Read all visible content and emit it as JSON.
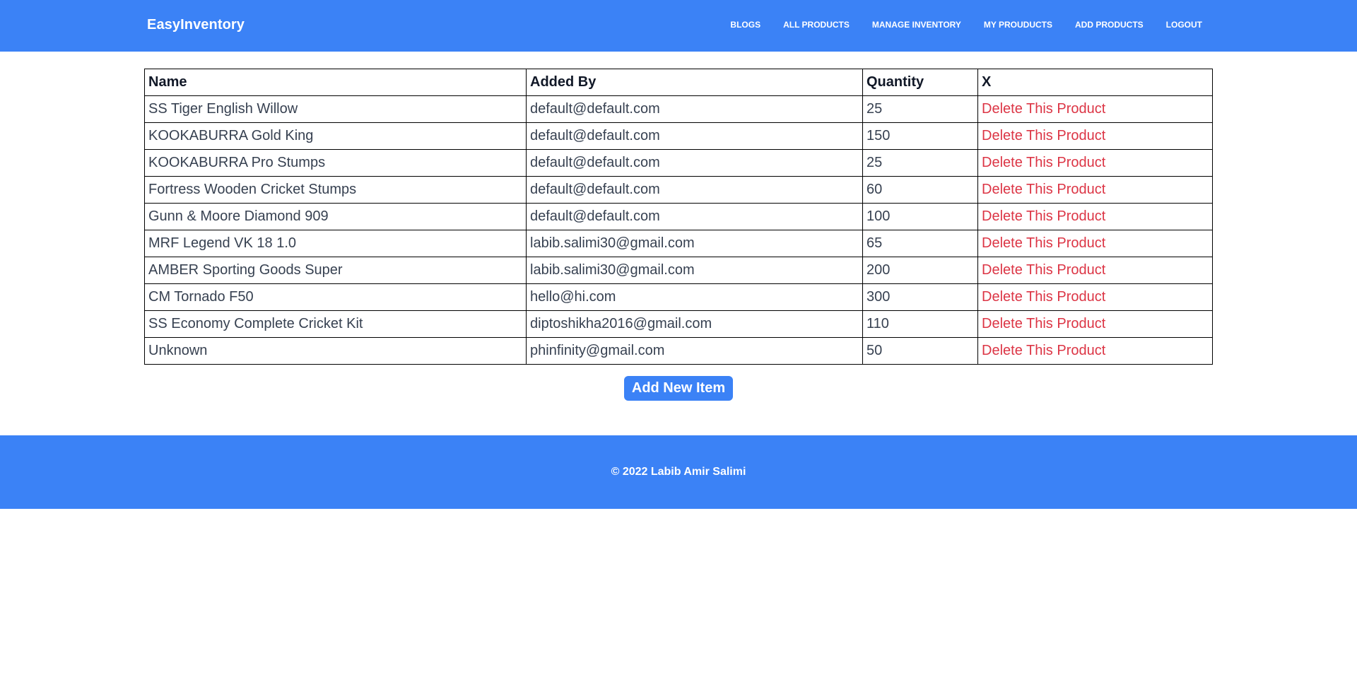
{
  "brand": "EasyInventory",
  "nav": {
    "links": [
      "BLOGS",
      "ALL PRODUCTS",
      "MANAGE INVENTORY",
      "MY PROUDUCTS",
      "ADD PRODUCTS",
      "LOGOUT"
    ]
  },
  "table": {
    "headers": [
      "Name",
      "Added By",
      "Quantity",
      "X"
    ],
    "rows": [
      {
        "name": "SS Tiger English Willow",
        "added_by": "default@default.com",
        "quantity": "25",
        "action": "Delete This Product"
      },
      {
        "name": "KOOKABURRA Gold King",
        "added_by": "default@default.com",
        "quantity": "150",
        "action": "Delete This Product"
      },
      {
        "name": "KOOKABURRA Pro Stumps",
        "added_by": "default@default.com",
        "quantity": "25",
        "action": "Delete This Product"
      },
      {
        "name": "Fortress Wooden Cricket Stumps",
        "added_by": "default@default.com",
        "quantity": "60",
        "action": "Delete This Product"
      },
      {
        "name": "Gunn & Moore Diamond 909",
        "added_by": "default@default.com",
        "quantity": "100",
        "action": "Delete This Product"
      },
      {
        "name": "MRF Legend VK 18 1.0",
        "added_by": "labib.salimi30@gmail.com",
        "quantity": "65",
        "action": "Delete This Product"
      },
      {
        "name": "AMBER Sporting Goods Super",
        "added_by": "labib.salimi30@gmail.com",
        "quantity": "200",
        "action": "Delete This Product"
      },
      {
        "name": "CM Tornado F50",
        "added_by": "hello@hi.com",
        "quantity": "300",
        "action": "Delete This Product"
      },
      {
        "name": "SS Economy Complete Cricket Kit",
        "added_by": "diptoshikha2016@gmail.com",
        "quantity": "110",
        "action": "Delete This Product"
      },
      {
        "name": "Unknown",
        "added_by": "phinfinity@gmail.com",
        "quantity": "50",
        "action": "Delete This Product"
      }
    ]
  },
  "add_button": "Add New Item",
  "footer": "© 2022 Labib Amir Salimi",
  "colors": {
    "primary": "#3b82f6",
    "delete": "#dc3545"
  }
}
